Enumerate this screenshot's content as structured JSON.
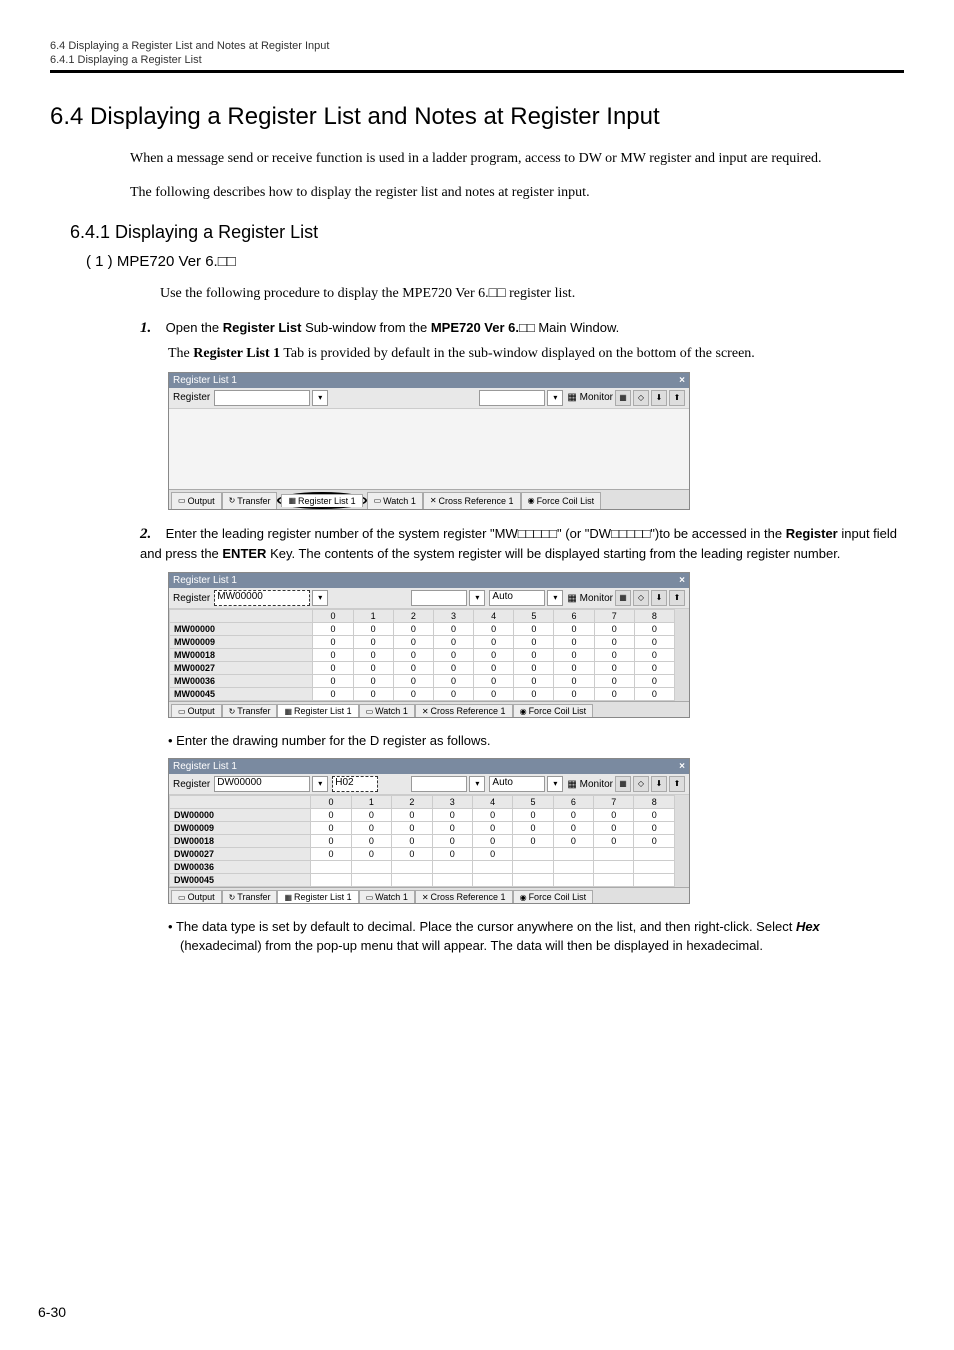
{
  "header": {
    "line1": "6.4  Displaying a Register List and Notes at Register Input",
    "line2": "6.4.1  Displaying a Register List"
  },
  "title": "6.4  Displaying a Register List and Notes at Register Input",
  "intro1": "When a message send or receive function is used in a ladder program, access to DW or MW register and input are required.",
  "intro2": "The following describes how to display the register list and notes at register input.",
  "sub641": "6.4.1  Displaying a Register List",
  "sub1": "( 1 )  MPE720 Ver 6.□□",
  "sub1_body": "Use the following procedure to display the MPE720 Ver 6.□□ register list.",
  "step1_num": "1.",
  "step1_a": "Open the ",
  "step1_b": "Register List",
  "step1_c": " Sub-window from the ",
  "step1_d": "MPE720 Ver 6.□□",
  "step1_e": " Main Window.",
  "step1_sub_a": "The ",
  "step1_sub_b": "Register List 1",
  "step1_sub_c": " Tab is provided by default in the sub-window displayed on the bottom of the screen.",
  "ss1": {
    "title": "Register List 1",
    "reg_label": "Register",
    "monitor_label": "Monitor",
    "tabs": [
      "Output",
      "Transfer",
      "Register List 1",
      "Watch 1",
      "Cross Reference 1",
      "Force Coil List"
    ]
  },
  "step2_num": "2.",
  "step2_a": "Enter the leading register number of the system register \"MW□□□□□\" (or \"DW□□□□□\")to be accessed in the ",
  "step2_b": "Register",
  "step2_c": " input field and press the ",
  "step2_d": "ENTER",
  "step2_e": " Key. The contents of the system register will be displayed starting from the leading register number.",
  "ss2": {
    "title": "Register List 1",
    "reg_label": "Register",
    "reg_value": "MW00000",
    "mode": "Auto",
    "monitor_label": "Monitor",
    "cols": [
      "0",
      "1",
      "2",
      "3",
      "4",
      "5",
      "6",
      "7",
      "8"
    ],
    "rows": [
      {
        "name": "MW00000",
        "v": [
          "0",
          "0",
          "0",
          "0",
          "0",
          "0",
          "0",
          "0",
          "0"
        ]
      },
      {
        "name": "MW00009",
        "v": [
          "0",
          "0",
          "0",
          "0",
          "0",
          "0",
          "0",
          "0",
          "0"
        ]
      },
      {
        "name": "MW00018",
        "v": [
          "0",
          "0",
          "0",
          "0",
          "0",
          "0",
          "0",
          "0",
          "0"
        ]
      },
      {
        "name": "MW00027",
        "v": [
          "0",
          "0",
          "0",
          "0",
          "0",
          "0",
          "0",
          "0",
          "0"
        ]
      },
      {
        "name": "MW00036",
        "v": [
          "0",
          "0",
          "0",
          "0",
          "0",
          "0",
          "0",
          "0",
          "0"
        ]
      },
      {
        "name": "MW00045",
        "v": [
          "0",
          "0",
          "0",
          "0",
          "0",
          "0",
          "0",
          "0",
          "0"
        ]
      }
    ],
    "tabs": [
      "Output",
      "Transfer",
      "Register List 1",
      "Watch 1",
      "Cross Reference 1",
      "Force Coil List"
    ]
  },
  "bullet1": "Enter the drawing number for the D register as follows.",
  "ss3": {
    "title": "Register List 1",
    "reg_label": "Register",
    "reg_value": "DW00000",
    "prog": "H02",
    "mode": "Auto",
    "monitor_label": "Monitor",
    "cols": [
      "0",
      "1",
      "2",
      "3",
      "4",
      "5",
      "6",
      "7",
      "8"
    ],
    "rows": [
      {
        "name": "DW00000",
        "v": [
          "0",
          "0",
          "0",
          "0",
          "0",
          "0",
          "0",
          "0",
          "0"
        ]
      },
      {
        "name": "DW00009",
        "v": [
          "0",
          "0",
          "0",
          "0",
          "0",
          "0",
          "0",
          "0",
          "0"
        ]
      },
      {
        "name": "DW00018",
        "v": [
          "0",
          "0",
          "0",
          "0",
          "0",
          "0",
          "0",
          "0",
          "0"
        ]
      },
      {
        "name": "DW00027",
        "v": [
          "0",
          "0",
          "0",
          "0",
          "0",
          "",
          "",
          "",
          ""
        ]
      },
      {
        "name": "DW00036",
        "v": [
          "",
          "",
          "",
          "",
          "",
          "",
          "",
          "",
          ""
        ]
      },
      {
        "name": "DW00045",
        "v": [
          "",
          "",
          "",
          "",
          "",
          "",
          "",
          "",
          ""
        ]
      }
    ],
    "tabs": [
      "Output",
      "Transfer",
      "Register List 1",
      "Watch 1",
      "Cross Reference 1",
      "Force Coil List"
    ]
  },
  "bullet2_a": "The data type is set by default to decimal. Place the cursor anywhere on the list, and then right-click. Select ",
  "bullet2_b": "Hex",
  "bullet2_c": " (hexadecimal) from the pop-up menu that will appear. The data will then be displayed in hexadecimal.",
  "pagenum": "6-30"
}
